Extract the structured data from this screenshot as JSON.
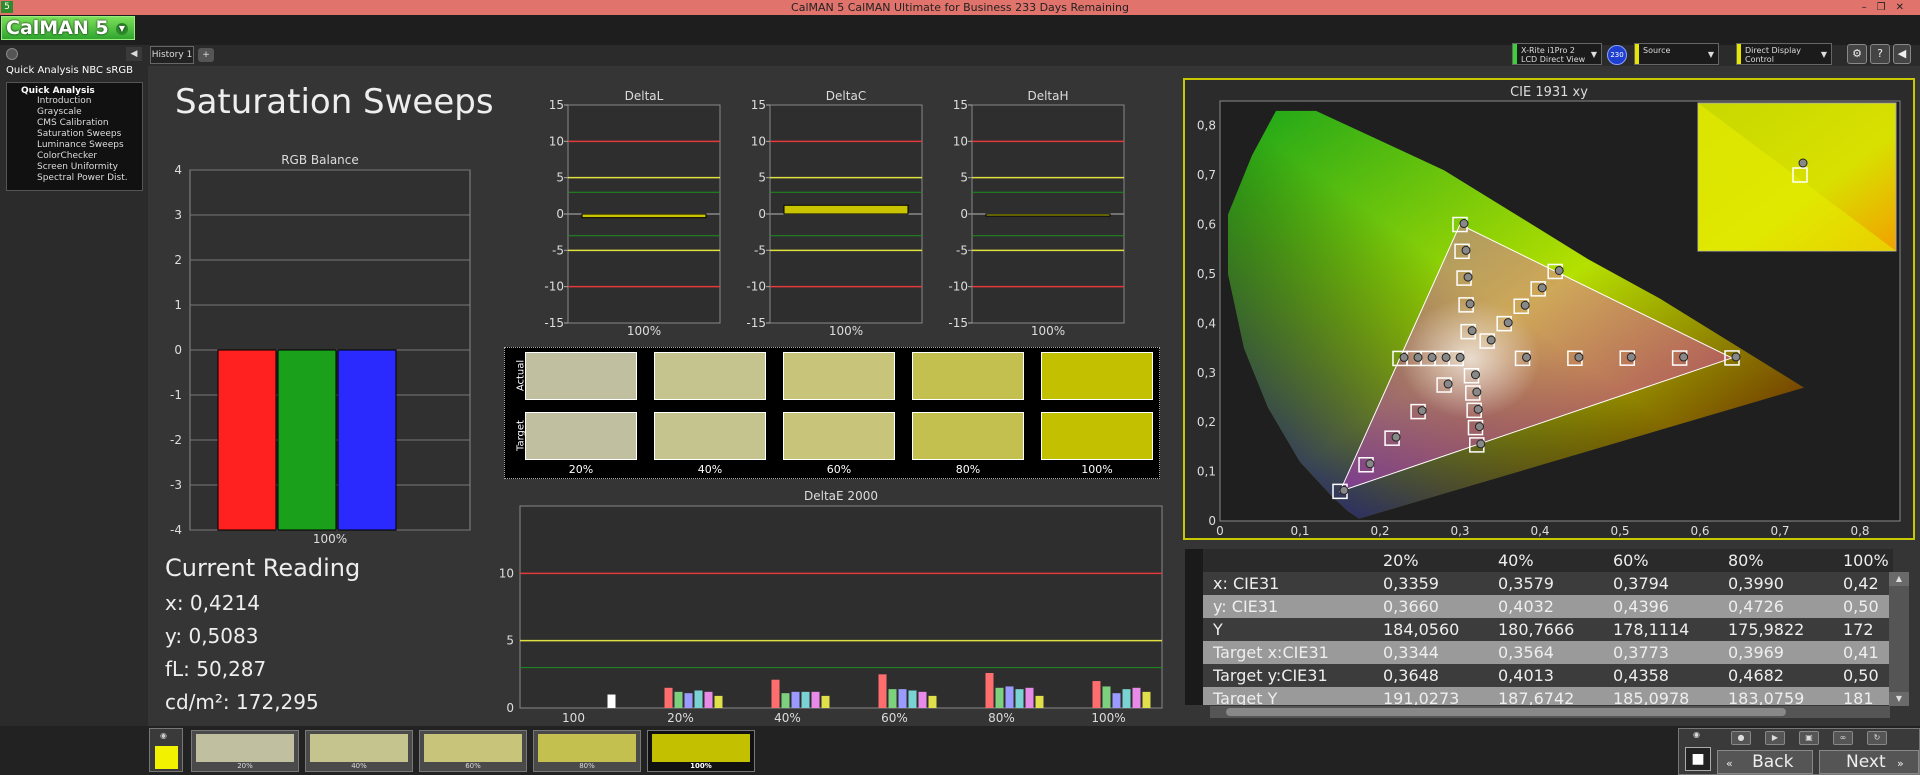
{
  "window": {
    "title": "CalMAN 5 CalMAN Ultimate for Business 233 Days Remaining",
    "icon_label": "5"
  },
  "app": {
    "logo_text": "CalMAN 5"
  },
  "sidebar": {
    "title": "Quick Analysis NBC sRGB",
    "group": "Quick Analysis",
    "items": [
      "Introduction",
      "Grayscale",
      "CMS Calibration",
      "Saturation Sweeps",
      "Luminance Sweeps",
      "ColorChecker",
      "Screen Uniformity",
      "Spectral Power Dist."
    ],
    "selected_index": 3
  },
  "tabs": {
    "history": "History 1",
    "add": "+"
  },
  "devices": {
    "meter_line1": "X-Rite i1Pro 2",
    "meter_line2": "LCD Direct View",
    "meter_badge": "230",
    "source": "Source",
    "display": "Direct Display Control"
  },
  "page": {
    "title": "Saturation Sweeps"
  },
  "rgb_balance": {
    "title": "RGB Balance",
    "x_label": "100%",
    "y_ticks": [
      "4",
      "3",
      "2",
      "1",
      "0",
      "-1",
      "-2",
      "-3",
      "-4"
    ],
    "ylim": [
      -4,
      4
    ],
    "bars": [
      {
        "name": "red",
        "value": -4,
        "color": "#ff2020"
      },
      {
        "name": "green",
        "value": -4,
        "color": "#1aa01a"
      },
      {
        "name": "blue",
        "value": -4,
        "color": "#2a2aff"
      }
    ]
  },
  "delta_charts": [
    {
      "title": "DeltaL",
      "x_label": "100%",
      "value": -0.5
    },
    {
      "title": "DeltaC",
      "x_label": "100%",
      "value": 1.2
    },
    {
      "title": "DeltaH",
      "x_label": "100%",
      "value": 0.0
    }
  ],
  "delta_ticks": [
    "15",
    "10",
    "5",
    "0",
    "-5",
    "-10",
    "-15"
  ],
  "swatches": {
    "actual_label": "Actual",
    "target_label": "Target",
    "labels": [
      "20%",
      "40%",
      "60%",
      "80%",
      "100%"
    ],
    "actual": [
      "#c0bfa0",
      "#c6c48e",
      "#c8c47a",
      "#c4c050",
      "#c3c000"
    ],
    "target": [
      "#c0bfa0",
      "#c6c48e",
      "#c8c47a",
      "#c4c050",
      "#c3c000"
    ]
  },
  "deltae": {
    "title": "DeltaE 2000",
    "y_ticks": [
      "10",
      "5",
      "0"
    ],
    "x_labels": [
      "100",
      "20%",
      "40%",
      "60%",
      "80%",
      "100%"
    ],
    "groups": [
      [
        0,
        0,
        0,
        0,
        0,
        1.0
      ],
      [
        1.5,
        1.2,
        1.1,
        1.3,
        1.2,
        0.9
      ],
      [
        2.1,
        1.1,
        1.2,
        1.2,
        1.2,
        0.9
      ],
      [
        2.5,
        1.4,
        1.4,
        1.3,
        1.2,
        0.9
      ],
      [
        2.6,
        1.5,
        1.6,
        1.4,
        1.5,
        0.9
      ],
      [
        2.0,
        1.6,
        1.1,
        1.4,
        1.5,
        1.2
      ]
    ],
    "colors": [
      "#ff6e6e",
      "#7dd07d",
      "#9a9aff",
      "#7ad2d2",
      "#e88ae8",
      "#e0e04a"
    ]
  },
  "current_reading": {
    "title": "Current Reading",
    "x": "x: 0,4214",
    "y": "y: 0,5083",
    "fl": "fL: 50,287",
    "cdm2": "cd/m²: 172,295"
  },
  "cie": {
    "title": "CIE 1931 xy",
    "x_ticks": [
      "0",
      "0,1",
      "0,2",
      "0,3",
      "0,4",
      "0,5",
      "0,6",
      "0,7",
      "0,8"
    ],
    "y_ticks": [
      "0,8",
      "0,7",
      "0,6",
      "0,5",
      "0,4",
      "0,3",
      "0,2",
      "0,1",
      "0"
    ]
  },
  "chart_data": [
    {
      "type": "bar",
      "title": "RGB Balance",
      "categories": [
        "100%"
      ],
      "series": [
        {
          "name": "red",
          "values": [
            -4
          ]
        },
        {
          "name": "green",
          "values": [
            -4
          ]
        },
        {
          "name": "blue",
          "values": [
            -4
          ]
        }
      ],
      "ylim": [
        -4,
        4
      ]
    },
    {
      "type": "bar",
      "title": "DeltaL",
      "categories": [
        "100%"
      ],
      "values": [
        -0.5
      ],
      "ylim": [
        -15,
        15
      ]
    },
    {
      "type": "bar",
      "title": "DeltaC",
      "categories": [
        "100%"
      ],
      "values": [
        1.2
      ],
      "ylim": [
        -15,
        15
      ]
    },
    {
      "type": "bar",
      "title": "DeltaH",
      "categories": [
        "100%"
      ],
      "values": [
        0.0
      ],
      "ylim": [
        -15,
        15
      ]
    },
    {
      "type": "bar",
      "title": "DeltaE 2000",
      "categories": [
        "100",
        "20%",
        "40%",
        "60%",
        "80%",
        "100%"
      ],
      "values": [
        [
          0,
          0,
          0,
          0,
          0,
          1.0
        ],
        [
          1.5,
          1.2,
          1.1,
          1.3,
          1.2,
          0.9
        ],
        [
          2.1,
          1.1,
          1.2,
          1.2,
          1.2,
          0.9
        ],
        [
          2.5,
          1.4,
          1.4,
          1.3,
          1.2,
          0.9
        ],
        [
          2.6,
          1.5,
          1.6,
          1.4,
          1.5,
          0.9
        ],
        [
          2.0,
          1.6,
          1.1,
          1.4,
          1.5,
          1.2
        ]
      ],
      "ylim": [
        0,
        15
      ]
    },
    {
      "type": "scatter",
      "title": "CIE 1931 xy",
      "xlim": [
        0,
        0.85
      ],
      "ylim": [
        0,
        0.85
      ],
      "targets": [
        [
          0.64,
          0.33
        ],
        [
          0.3,
          0.6
        ],
        [
          0.15,
          0.06
        ],
        [
          0.3344,
          0.3648
        ],
        [
          0.3564,
          0.4013
        ],
        [
          0.3773,
          0.4358
        ],
        [
          0.3969,
          0.4682
        ],
        [
          0.419,
          0.505
        ]
      ],
      "actuals": [
        [
          0.3359,
          0.366
        ],
        [
          0.3579,
          0.4032
        ],
        [
          0.3794,
          0.4396
        ],
        [
          0.399,
          0.4726
        ],
        [
          0.4214,
          0.5083
        ]
      ]
    }
  ],
  "table": {
    "headers": [
      "20%",
      "40%",
      "60%",
      "80%",
      "100%"
    ],
    "rows": [
      {
        "label": "x: CIE31",
        "values": [
          "0,3359",
          "0,3579",
          "0,3794",
          "0,3990",
          "0,42"
        ]
      },
      {
        "label": "y: CIE31",
        "values": [
          "0,3660",
          "0,4032",
          "0,4396",
          "0,4726",
          "0,50"
        ]
      },
      {
        "label": "Y",
        "values": [
          "184,0560",
          "180,7666",
          "178,1114",
          "175,9822",
          "172"
        ]
      },
      {
        "label": "Target x:CIE31",
        "values": [
          "0,3344",
          "0,3564",
          "0,3773",
          "0,3969",
          "0,41"
        ]
      },
      {
        "label": "Target y:CIE31",
        "values": [
          "0,3648",
          "0,4013",
          "0,4358",
          "0,4682",
          "0,50"
        ]
      },
      {
        "label": "Target Y",
        "values": [
          "191,0273",
          "187,6742",
          "185,0978",
          "183,0759",
          "181"
        ]
      }
    ]
  },
  "bottom": {
    "thumbs": [
      {
        "label": "20%",
        "color": "#c0bfa0"
      },
      {
        "label": "40%",
        "color": "#c6c48e"
      },
      {
        "label": "60%",
        "color": "#c8c47a"
      },
      {
        "label": "80%",
        "color": "#c4c050"
      },
      {
        "label": "100%",
        "color": "#c3c000"
      }
    ],
    "current_color": "#f2f200",
    "back": "Back",
    "next": "Next"
  }
}
